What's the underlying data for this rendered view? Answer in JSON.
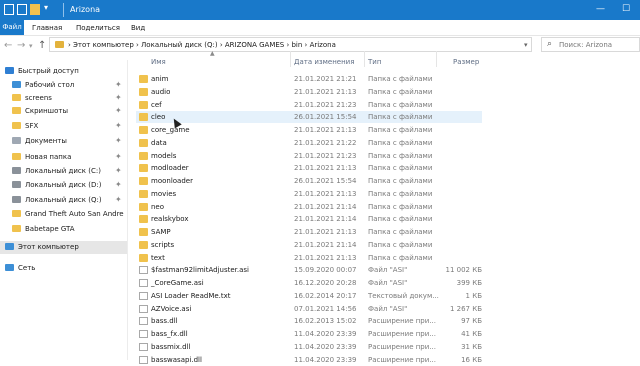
{
  "window": {
    "title": "Arizona",
    "minimize": "—",
    "maximize": "☐"
  },
  "menu": [
    "Файл",
    "Главная",
    "Поделиться",
    "Вид"
  ],
  "address": {
    "crumbs": "›  Этот компьютер  ›  Локальный диск (Q:)  ›  ARIZONA GAMES  ›  bin  ›  Arizona",
    "search_placeholder": "Поиск: Arizona"
  },
  "columns": {
    "name": "Имя",
    "date": "Дата изменения",
    "type": "Тип",
    "size": "Размер"
  },
  "sidebar": [
    {
      "label": "Быстрый доступ",
      "icon": "star-icon",
      "pinned": false
    },
    {
      "label": "Рабочий стол",
      "icon": "desktop-folder-icon",
      "pinned": true
    },
    {
      "label": "screens",
      "icon": "folder-icon",
      "pinned": true
    },
    {
      "label": "Скриншоты",
      "icon": "folder-icon",
      "pinned": true
    },
    {
      "label": "SFX",
      "icon": "folder-icon",
      "pinned": true
    },
    {
      "label": "Документы",
      "icon": "documents-icon",
      "pinned": true
    },
    {
      "label": "Новая папка",
      "icon": "folder-icon",
      "pinned": true
    },
    {
      "label": "Локальный диск (C:)",
      "icon": "drive-icon",
      "pinned": true
    },
    {
      "label": "Локальный диск (D:)",
      "icon": "drive-icon",
      "pinned": true
    },
    {
      "label": "Локальный диск (Q:)",
      "icon": "drive-icon",
      "pinned": true
    },
    {
      "label": "Grand Theft Auto  San Andre",
      "icon": "folder-icon",
      "pinned": false
    },
    {
      "label": "Babetape GTA",
      "icon": "folder-icon",
      "pinned": false
    },
    {
      "label": "Этот компьютер",
      "icon": "computer-icon",
      "pinned": false
    },
    {
      "label": "Сеть",
      "icon": "network-icon",
      "pinned": false
    }
  ],
  "files": [
    {
      "name": "anim",
      "date": "21.01.2021 21:21",
      "type": "Папка с файлами",
      "size": "",
      "kind": "folder"
    },
    {
      "name": "audio",
      "date": "21.01.2021 21:13",
      "type": "Папка с файлами",
      "size": "",
      "kind": "folder"
    },
    {
      "name": "cef",
      "date": "21.01.2021 21:23",
      "type": "Папка с файлами",
      "size": "",
      "kind": "folder"
    },
    {
      "name": "cleo",
      "date": "26.01.2021 15:54",
      "type": "Папка с файлами",
      "size": "",
      "kind": "folder"
    },
    {
      "name": "core_game",
      "date": "21.01.2021 21:13",
      "type": "Папка с файлами",
      "size": "",
      "kind": "folder"
    },
    {
      "name": "data",
      "date": "21.01.2021 21:22",
      "type": "Папка с файлами",
      "size": "",
      "kind": "folder"
    },
    {
      "name": "models",
      "date": "21.01.2021 21:23",
      "type": "Папка с файлами",
      "size": "",
      "kind": "folder"
    },
    {
      "name": "modloader",
      "date": "21.01.2021 21:13",
      "type": "Папка с файлами",
      "size": "",
      "kind": "folder"
    },
    {
      "name": "moonloader",
      "date": "26.01.2021 15:54",
      "type": "Папка с файлами",
      "size": "",
      "kind": "folder"
    },
    {
      "name": "movies",
      "date": "21.01.2021 21:13",
      "type": "Папка с файлами",
      "size": "",
      "kind": "folder"
    },
    {
      "name": "neo",
      "date": "21.01.2021 21:14",
      "type": "Папка с файлами",
      "size": "",
      "kind": "folder"
    },
    {
      "name": "realskybox",
      "date": "21.01.2021 21:14",
      "type": "Папка с файлами",
      "size": "",
      "kind": "folder"
    },
    {
      "name": "SAMP",
      "date": "21.01.2021 21:13",
      "type": "Папка с файлами",
      "size": "",
      "kind": "folder"
    },
    {
      "name": "scripts",
      "date": "21.01.2021 21:14",
      "type": "Папка с файлами",
      "size": "",
      "kind": "folder"
    },
    {
      "name": "text",
      "date": "21.01.2021 21:13",
      "type": "Папка с файлами",
      "size": "",
      "kind": "folder"
    },
    {
      "name": "$fastman92limitAdjuster.asi",
      "date": "15.09.2020 00:07",
      "type": "Файл \"ASI\"",
      "size": "11 002 КБ",
      "kind": "file"
    },
    {
      "name": "_CoreGame.asi",
      "date": "16.12.2020 20:28",
      "type": "Файл \"ASI\"",
      "size": "399 КБ",
      "kind": "file"
    },
    {
      "name": "ASI Loader ReadMe.txt",
      "date": "16.02.2014 20:17",
      "type": "Текстовый докум...",
      "size": "1 КБ",
      "kind": "file"
    },
    {
      "name": "AZVoice.asi",
      "date": "07.01.2021 14:56",
      "type": "Файл \"ASI\"",
      "size": "1 267 КБ",
      "kind": "file"
    },
    {
      "name": "bass.dll",
      "date": "16.02.2013 15:02",
      "type": "Расширение при...",
      "size": "97 КБ",
      "kind": "file"
    },
    {
      "name": "bass_fx.dll",
      "date": "11.04.2020 23:39",
      "type": "Расширение при...",
      "size": "41 КБ",
      "kind": "file"
    },
    {
      "name": "bassmix.dll",
      "date": "11.04.2020 23:39",
      "type": "Расширение при...",
      "size": "31 КБ",
      "kind": "file"
    },
    {
      "name": "basswasapi.dll",
      "date": "11.04.2020 23:39",
      "type": "Расширение при...",
      "size": "16 КБ",
      "kind": "file"
    }
  ],
  "hover_row": 3
}
